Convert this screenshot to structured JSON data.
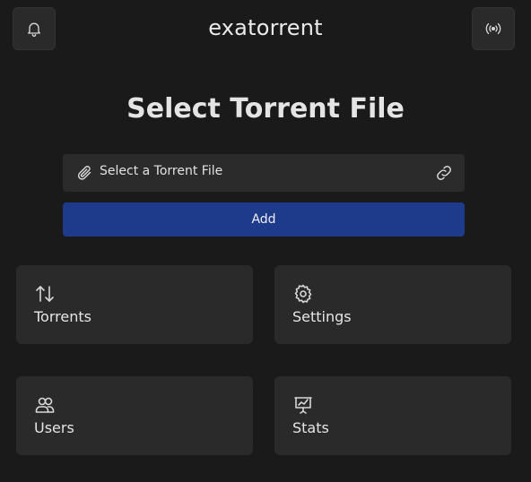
{
  "header": {
    "title": "exatorrent",
    "notifications_icon": "bell-icon",
    "connection_icon": "broadcast-icon"
  },
  "main": {
    "heading": "Select Torrent File",
    "file_input": {
      "placeholder": "Select a Torrent File",
      "left_icon": "paperclip-icon",
      "right_icon": "link-icon"
    },
    "add_button_label": "Add"
  },
  "cards": [
    {
      "label": "Torrents",
      "icon": "arrows-up-down-icon"
    },
    {
      "label": "Settings",
      "icon": "gear-icon"
    },
    {
      "label": "Users",
      "icon": "users-icon"
    },
    {
      "label": "Stats",
      "icon": "presentation-chart-icon"
    }
  ],
  "colors": {
    "background": "#1a1a1a",
    "surface": "#2a2a2a",
    "accent": "#1e3a8a",
    "text": "#e6e6e6"
  }
}
